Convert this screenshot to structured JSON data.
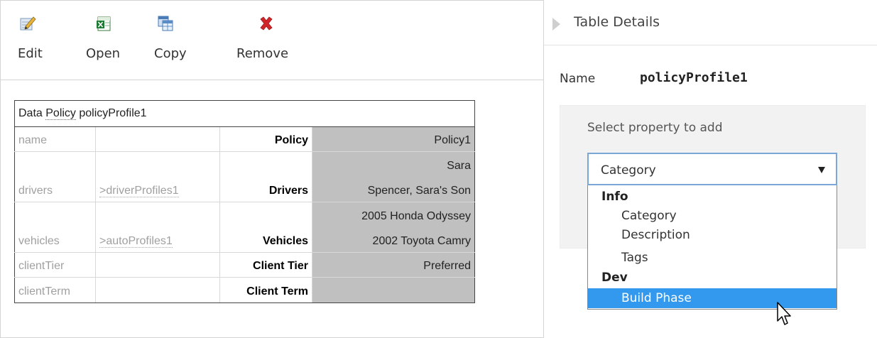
{
  "toolbar": {
    "buttons": [
      {
        "label": "Edit",
        "icon": "edit-icon"
      },
      {
        "label": "Open",
        "icon": "excel-icon"
      },
      {
        "label": "Copy",
        "icon": "copy-table-icon"
      },
      {
        "label": "Remove",
        "icon": "red-x-icon"
      }
    ]
  },
  "policy_table": {
    "caption": {
      "prefix": "Data ",
      "linked": "Policy",
      "suffix": " policyProfile1"
    },
    "rows": [
      {
        "name": "name",
        "ref": "",
        "label": "Policy",
        "values": [
          "Policy1"
        ]
      },
      {
        "name": "drivers",
        "ref": ">driverProfiles1",
        "label": "Drivers",
        "values": [
          "Sara",
          "Spencer, Sara's Son"
        ]
      },
      {
        "name": "vehicles",
        "ref": ">autoProfiles1",
        "label": "Vehicles",
        "values": [
          "2005 Honda Odyssey",
          "2002 Toyota Camry"
        ]
      },
      {
        "name": "clientTier",
        "ref": "",
        "label": "Client Tier",
        "values": [
          "Preferred"
        ]
      },
      {
        "name": "clientTerm",
        "ref": "",
        "label": "Client Term",
        "values": [
          ""
        ]
      }
    ]
  },
  "details": {
    "title": "Table Details",
    "name_label": "Name",
    "name_value": "policyProfile1",
    "prompt": "Select property to add",
    "select_value": "Category",
    "dropdown": {
      "groups": [
        {
          "label": "Info",
          "options": [
            "Category",
            "Description",
            "Tags"
          ]
        },
        {
          "label": "Dev",
          "options": [
            "Build Phase"
          ]
        }
      ],
      "highlighted": "Build Phase"
    }
  },
  "colors": {
    "value_cell_bg": "#c0c0c0",
    "dropdown_highlight": "#3399ee",
    "select_border": "#7aa7d6",
    "remove_icon": "#d0262a"
  }
}
